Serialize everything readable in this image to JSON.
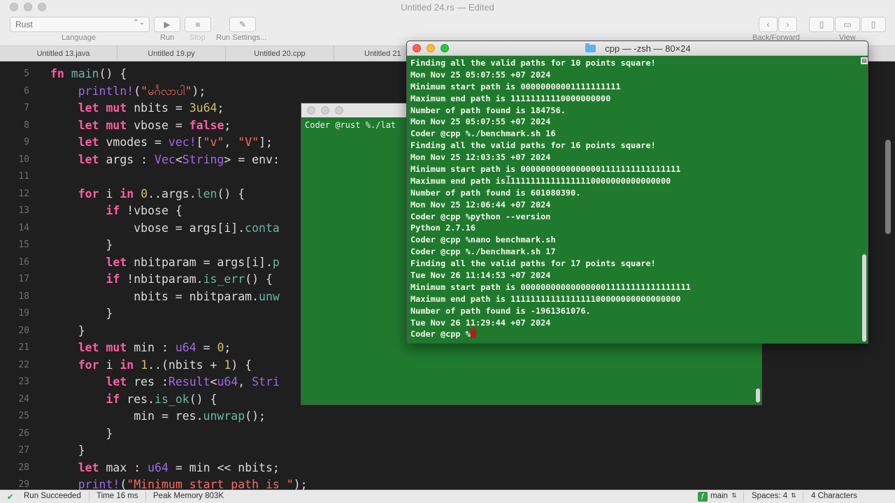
{
  "window": {
    "title": "Untitled 24.rs",
    "edited": " — Edited"
  },
  "toolbar": {
    "language_value": "Rust",
    "language_label": "Language",
    "run_label": "Run",
    "stop_label": "Stop",
    "run_settings_label": "Run Settings...",
    "back_forward_label": "Back/Forward",
    "view_label": "View"
  },
  "tabs": [
    "Untitled 13.java",
    "Untitled 19.py",
    "Untitled 20.cpp",
    "Untitled 21"
  ],
  "code": {
    "line_numbers": [
      "5",
      "6",
      "7",
      "8",
      "9",
      "10",
      "11",
      "12",
      "13",
      "14",
      "15",
      "16",
      "17",
      "18",
      "19",
      "20",
      "21",
      "22",
      "23",
      "24",
      "25",
      "26",
      "27",
      "28",
      "29"
    ],
    "lines": [
      "fn main() {",
      "    println!(\"မင်္ဂလာပါ\");",
      "    let mut nbits = 3u64;",
      "    let mut vbose = false;",
      "    let vmodes = vec![\"v\", \"V\"];",
      "    let args : Vec<String> = env:",
      "",
      "    for i in 0..args.len() {",
      "        if !vbose {",
      "            vbose = args[i].conta",
      "        }",
      "        let nbitparam = args[i].p",
      "        if !nbitparam.is_err() {",
      "            nbits = nbitparam.unw",
      "        }",
      "    }",
      "    let mut min : u64 = 0;",
      "    for i in 1..(nbits + 1) {",
      "        let res :Result<u64, Stri",
      "        if res.is_ok() {",
      "            min = res.unwrap();",
      "        }",
      "    }",
      "    let max : u64 = min << nbits;",
      "    print!(\"Minimum start path is \");"
    ]
  },
  "statusbar": {
    "run_status": "Run Succeeded",
    "time": "Time 16 ms",
    "memory": "Peak Memory 803K",
    "branch": "main",
    "spaces": "Spaces: 4",
    "characters": "4 Characters"
  },
  "terminal_back": {
    "text": "Coder @rust %./lat"
  },
  "terminal_front": {
    "title": "cpp — -zsh — 80×24",
    "lines": [
      "Finding all the valid paths for 10 points square!",
      "Mon Nov 25 05:07:55 +07 2024",
      "Minimum start path is 00000000001111111111",
      "Maximum end path is 11111111110000000000",
      "Number of path found is 184756.",
      "Mon Nov 25 05:07:55 +07 2024",
      "Coder @cpp %./benchmark.sh 16",
      "Finding all the valid paths for 16 points square!",
      "Mon Nov 25 12:03:35 +07 2024",
      "Minimum start path is 00000000000000001111111111111111",
      "Maximum end path is 11111111111111110000000000000000",
      "Number of path found is 601080390.",
      "Mon Nov 25 12:06:44 +07 2024",
      "Coder @cpp %python --version",
      "Python 2.7.16",
      "Coder @cpp %nano benchmark.sh",
      "Coder @cpp %./benchmark.sh 17",
      "Finding all the valid paths for 17 points square!",
      "Tue Nov 26 11:14:53 +07 2024",
      "Minimum start path is 0000000000000000011111111111111111",
      "Maximum end path is 1111111111111111100000000000000000",
      "Number of path found is -1961361076.",
      "Tue Nov 26 11:29:44 +07 2024"
    ],
    "prompt": "Coder @cpp %"
  },
  "colors": {
    "terminal_bg": "#1f7a2e",
    "editor_bg": "#1f1f1f",
    "keyword": "#fc5fa3",
    "string": "#fc6a5d"
  }
}
